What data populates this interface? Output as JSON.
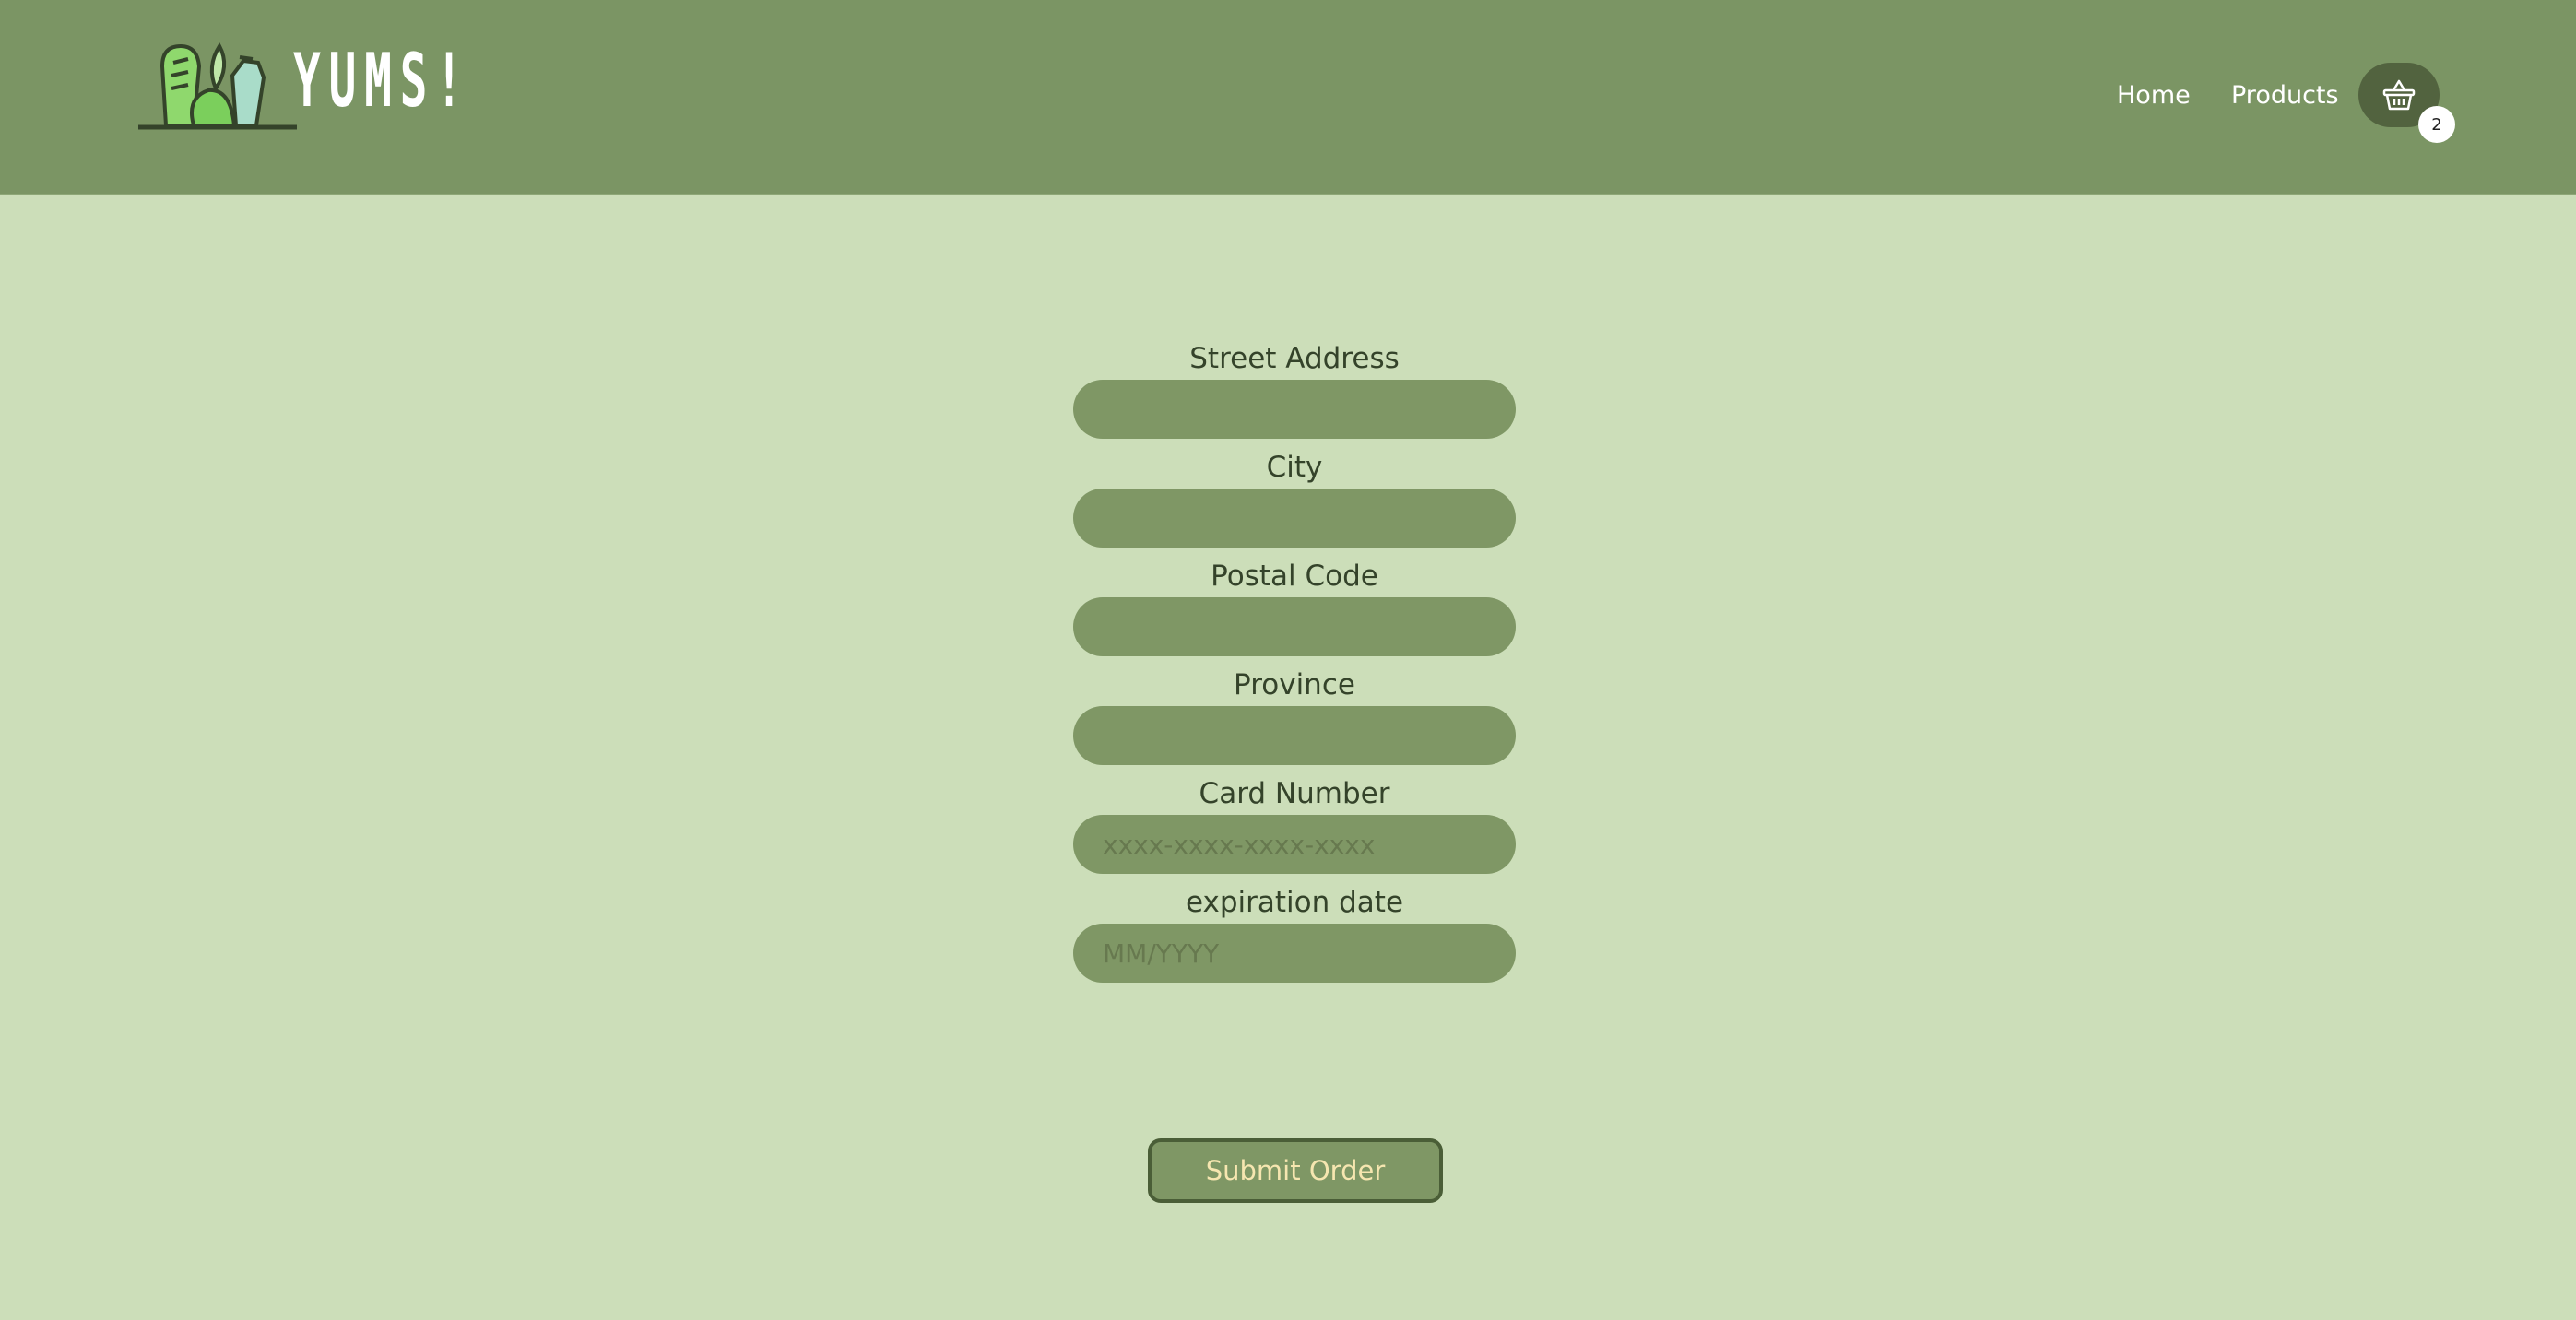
{
  "header": {
    "logo_text": "YUMS!",
    "nav": {
      "home": "Home",
      "products": "Products"
    },
    "cart": {
      "icon": "basket-icon",
      "count": "2"
    }
  },
  "form": {
    "fields": [
      {
        "label": "Street Address",
        "value": "",
        "placeholder": ""
      },
      {
        "label": "City",
        "value": "",
        "placeholder": ""
      },
      {
        "label": "Postal Code",
        "value": "",
        "placeholder": ""
      },
      {
        "label": "Province",
        "value": "",
        "placeholder": ""
      },
      {
        "label": "Card Number",
        "value": "",
        "placeholder": "xxxx-xxxx-xxxx-xxxx"
      },
      {
        "label": "expiration date",
        "value": "",
        "placeholder": "MM/YYYY"
      }
    ],
    "submit_label": "Submit Order"
  },
  "colors": {
    "header_bg": "#7b9564",
    "page_bg": "#ccdeb9",
    "input_bg": "#7f9765",
    "cart_bg": "#52633f",
    "submit_text": "#f6e6b0"
  }
}
